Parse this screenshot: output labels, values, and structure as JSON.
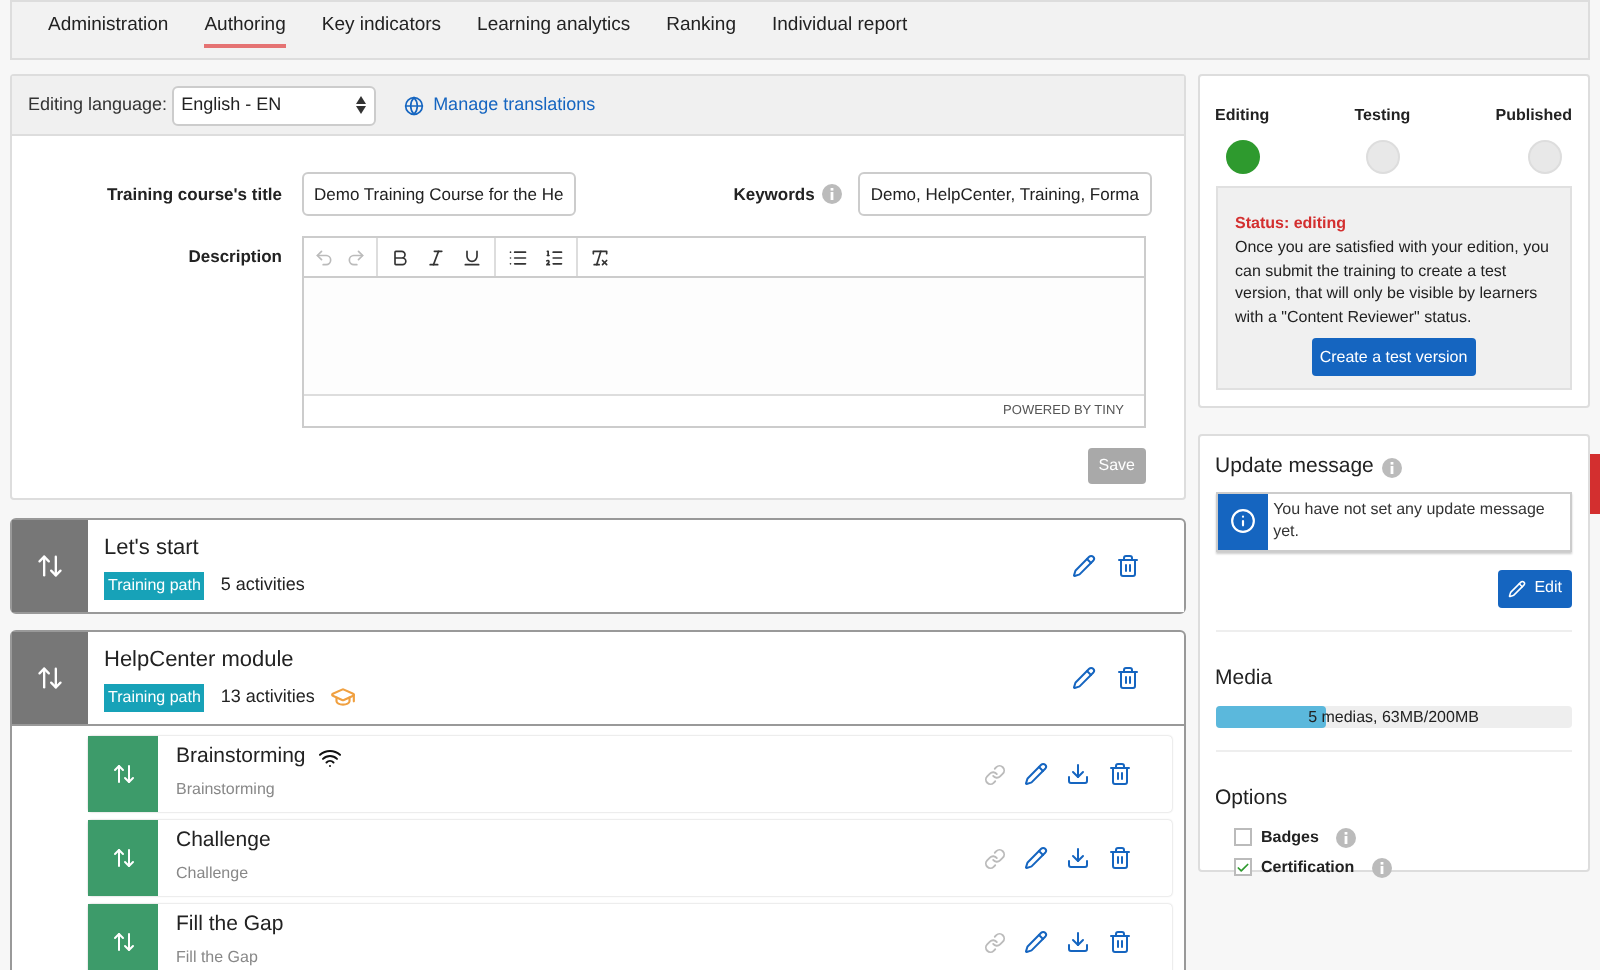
{
  "tabs": [
    {
      "label": "Administration",
      "selected": false
    },
    {
      "label": "Authoring",
      "selected": true
    },
    {
      "label": "Key indicators",
      "selected": false
    },
    {
      "label": "Learning analytics",
      "selected": false
    },
    {
      "label": "Ranking",
      "selected": false
    },
    {
      "label": "Individual report",
      "selected": false
    }
  ],
  "language_bar": {
    "label": "Editing language:",
    "value": "English - EN",
    "link": "Manage translations"
  },
  "form": {
    "title_label": "Training course's title",
    "title_value": "Demo Training Course for the He",
    "keywords_label": "Keywords",
    "keywords_value": "Demo, HelpCenter, Training, Forma",
    "description_label": "Description",
    "editor_footer": "POWERED BY TINY",
    "save": "Save",
    "save_disabled": true
  },
  "modules": [
    {
      "title": "Let's start",
      "tag": "Training path",
      "count": "5 activities",
      "certified": false,
      "expanded": false
    },
    {
      "title": "HelpCenter module",
      "tag": "Training path",
      "count": "13 activities",
      "certified": true,
      "expanded": true,
      "children": [
        {
          "title": "Brainstorming",
          "type": "Brainstorming",
          "wireless": true
        },
        {
          "title": "Challenge",
          "type": "Challenge",
          "wireless": false
        },
        {
          "title": "Fill the Gap",
          "type": "Fill the Gap",
          "wireless": false
        }
      ]
    }
  ],
  "status": {
    "steps": [
      {
        "label": "Editing",
        "selected": true
      },
      {
        "label": "Testing",
        "selected": false
      },
      {
        "label": "Published",
        "selected": false
      }
    ],
    "heading": "Status: editing",
    "text": "Once you are satisfied with your edition, you can submit the training to create a test version, that will only be visible by learners with a \"Content Reviewer\" status.",
    "button": "Create a test version"
  },
  "update_message": {
    "title": "Update message",
    "text": "You have not set any update message yet.",
    "button": "Edit"
  },
  "media": {
    "title": "Media",
    "reading": "5 medias, 63MB/200MB",
    "level": 0.31
  },
  "options": {
    "title": "Options",
    "items": [
      {
        "label": "Badges",
        "checked": false
      },
      {
        "label": "Certification",
        "checked": true
      }
    ]
  }
}
